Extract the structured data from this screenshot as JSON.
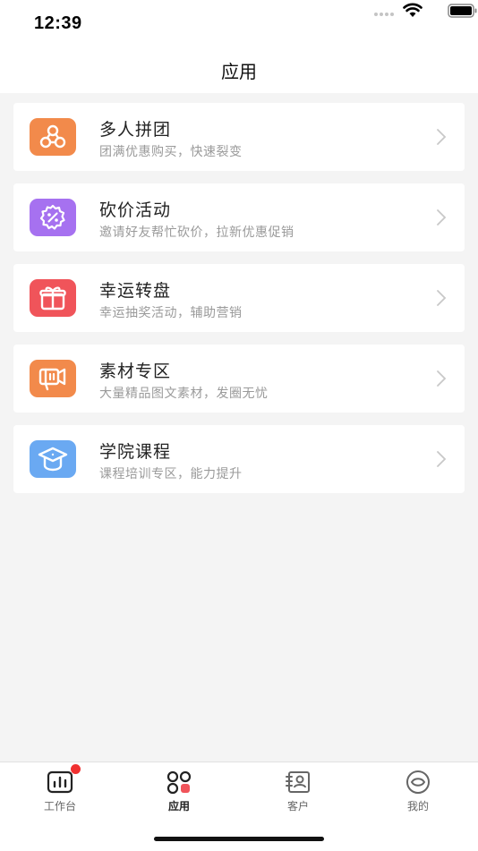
{
  "status": {
    "time": "12:39"
  },
  "nav": {
    "title": "应用"
  },
  "apps": [
    {
      "title": "多人拼团",
      "desc": "团满优惠购买，快速裂变",
      "icon": "group-buy-icon",
      "color": "#f28a4b"
    },
    {
      "title": "砍价活动",
      "desc": "邀请好友帮忙砍价，拉新优惠促销",
      "icon": "bargain-icon",
      "color": "#a671f0"
    },
    {
      "title": "幸运转盘",
      "desc": "幸运抽奖活动，辅助营销",
      "icon": "gift-icon",
      "color": "#f0545a"
    },
    {
      "title": "素材专区",
      "desc": "大量精品图文素材，发圈无忧",
      "icon": "megaphone-icon",
      "color": "#f28a4b"
    },
    {
      "title": "学院课程",
      "desc": "课程培训专区，能力提升",
      "icon": "graduation-cap-icon",
      "color": "#6aa9f2"
    }
  ],
  "tabs": [
    {
      "label": "工作台",
      "icon": "dashboard-icon",
      "badge": true
    },
    {
      "label": "应用",
      "icon": "apps-icon",
      "active": true
    },
    {
      "label": "客户",
      "icon": "contacts-icon"
    },
    {
      "label": "我的",
      "icon": "profile-eye-icon"
    }
  ]
}
